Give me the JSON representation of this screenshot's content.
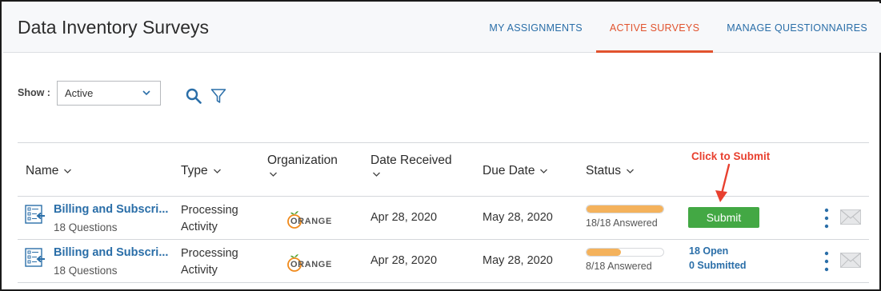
{
  "header": {
    "title": "Data Inventory Surveys",
    "tabs": [
      {
        "label": "MY ASSIGNMENTS",
        "active": false
      },
      {
        "label": "ACTIVE SURVEYS",
        "active": true
      },
      {
        "label": "MANAGE QUESTIONNAIRES",
        "active": false
      }
    ],
    "accent_color": "#e1532e",
    "link_color": "#2a6ea8"
  },
  "filter": {
    "show_label": "Show :",
    "selected": "Active"
  },
  "table": {
    "columns": [
      {
        "label": "Name"
      },
      {
        "label": "Type"
      },
      {
        "label": "Organization"
      },
      {
        "label": "Date Received"
      },
      {
        "label": "Due Date"
      },
      {
        "label": "Status"
      }
    ],
    "rows": [
      {
        "name": "Billing and Subscri...",
        "questions": "18 Questions",
        "type_line1": "Processing",
        "type_line2": "Activity",
        "org": "ORANGE",
        "date_received": "Apr 28, 2020",
        "due_date": "May 28, 2020",
        "progress": 1.0,
        "answered": "18/18 Answered",
        "action": "Submit"
      },
      {
        "name": "Billing and Subscri...",
        "questions": "18 Questions",
        "type_line1": "Processing",
        "type_line2": "Activity",
        "org": "ORANGE",
        "date_received": "Apr 28, 2020",
        "due_date": "May 28, 2020",
        "progress": 0.444,
        "answered": "8/18 Answered",
        "open": "18 Open",
        "submitted": "0 Submitted"
      }
    ]
  },
  "annotation": {
    "text": "Click to Submit",
    "color": "#e8402f"
  },
  "colors": {
    "progress": "#f4b25c",
    "submit": "#43a844"
  }
}
